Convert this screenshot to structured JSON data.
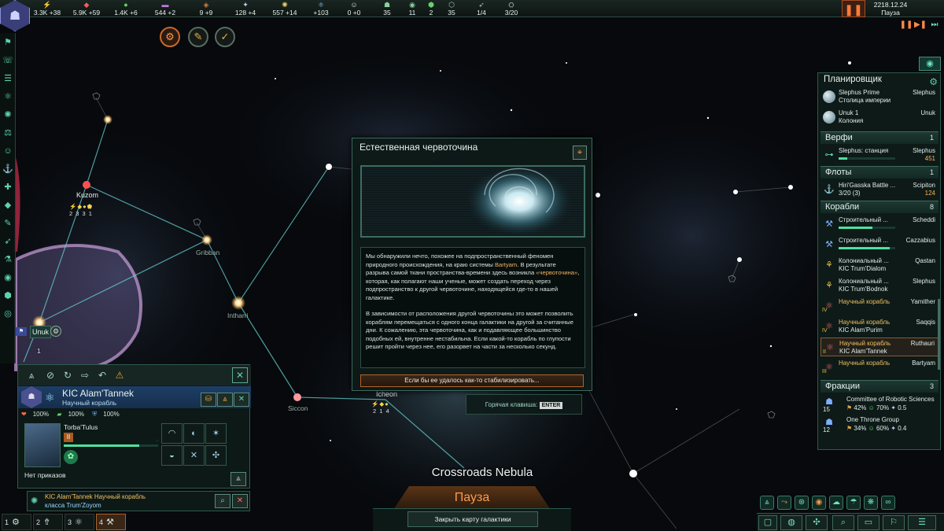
{
  "topbar": {
    "resources": [
      {
        "icon": "energy-icon",
        "glyph": "⚡",
        "value": "3.3K +38",
        "color": "#ffd24a"
      },
      {
        "icon": "minerals-icon",
        "glyph": "◆",
        "value": "5.9K +59",
        "color": "#ff5a5a"
      },
      {
        "icon": "food-icon",
        "glyph": "●",
        "value": "1.4K +6",
        "color": "#6ad06a"
      },
      {
        "icon": "alloys-icon",
        "glyph": "▬",
        "value": "544 +2",
        "color": "#c07ae0"
      },
      {
        "icon": "consumer-goods-icon",
        "glyph": "◈",
        "value": "9 +9",
        "color": "#e07a3a"
      },
      {
        "icon": "influence-icon",
        "glyph": "✦",
        "value": "128 +4",
        "color": "#b0d0f0"
      },
      {
        "icon": "unity-icon",
        "glyph": "✺",
        "value": "557 +14",
        "color": "#e0d070"
      },
      {
        "icon": "research-icon",
        "glyph": "⚛",
        "value": "+103",
        "color": "#7ac8f0"
      },
      {
        "icon": "amenities-icon",
        "glyph": "☺",
        "value": "0 +0",
        "color": "#e0e0e0"
      },
      {
        "icon": "pops-icon",
        "glyph": "☗",
        "value": "35",
        "color": "#8ad0a0"
      },
      {
        "icon": "planets-icon",
        "glyph": "◉",
        "value": "11",
        "color": "#8ad0a0"
      },
      {
        "icon": "stability-icon",
        "glyph": "⬢",
        "value": "2",
        "color": "#6ad06a"
      },
      {
        "icon": "sprawl-icon",
        "glyph": "⬡",
        "value": "35",
        "color": "#a0c0b0"
      },
      {
        "icon": "ships-icon",
        "glyph": "➶",
        "value": "1/4",
        "color": "#a0c0b0"
      },
      {
        "icon": "fleet-icon",
        "glyph": "⛭",
        "value": "3/20",
        "color": "#a0c0b0"
      }
    ],
    "date": "2218.12.24",
    "status": "Пауза"
  },
  "map": {
    "systems": [
      {
        "name": "Kuzom"
      },
      {
        "name": "Gribban"
      },
      {
        "name": "Intharri"
      },
      {
        "name": "Siccon"
      },
      {
        "name": "Icheon"
      },
      {
        "name": "Unuk"
      }
    ],
    "kuzom_res": "2 3 3 1",
    "icheon_res": "2 1 4",
    "unuk_count": "1",
    "nebula": "Crossroads Nebula"
  },
  "dialog": {
    "title": "Естественная червоточина",
    "p1_a": "Мы обнаружили нечто, похожее на подпространственный феномен природного происхождения, на краю системы ",
    "p1_sys": "Bartyam",
    "p1_b": ". В результате разрыва самой ткани пространства-времени здесь возникла ",
    "p1_hl": "«червоточина»",
    "p1_c": ", которая, как полагают наши ученые, может создать переход через подпространство к другой червоточине, находящейся где-то в нашей галактике.",
    "p2": "В зависимости от расположения другой червоточины это может позволить кораблям перемещаться с одного конца галактики на другой за считанные дни. К сожалению, эта червоточина, как и подавляющее большинство подобных ей, внутренне нестабильна. Если какой-то корабль по глупости решит пройти через нее, его разорвет на части за несколько секунд.",
    "option": "Если бы ее удалось как-то стабилизировать...",
    "hotkey_label": "Горячая клавиша:",
    "hotkey": "ENTER"
  },
  "planner": {
    "title": "Планировщик",
    "planets": [
      {
        "name": "Slephus Prime",
        "sub": "Столица империи",
        "right": "Slephus"
      },
      {
        "name": "Unuk 1",
        "sub": "Колония",
        "right": "Unuk"
      }
    ],
    "shipyards": {
      "label": "Верфи",
      "count": "1"
    },
    "shipyard_rows": [
      {
        "name": "Slephus: станция",
        "right": "Slephus",
        "value": "451"
      }
    ],
    "fleets": {
      "label": "Флоты",
      "count": "1"
    },
    "fleet_rows": [
      {
        "name": "Hiri'Gasska Battle ...",
        "sub": "3/20 (3)",
        "right": "Scipiton",
        "value": "124"
      }
    ],
    "ships": {
      "label": "Корабли",
      "count": "8"
    },
    "ship_rows": [
      {
        "name": "Строительный ...",
        "sub": "",
        "right": "Scheddi",
        "level": "",
        "progress": 0.6
      },
      {
        "name": "Строительный ...",
        "sub": "",
        "right": "Cazzabius",
        "level": "",
        "progress": 0.9
      },
      {
        "name": "Колониальный ...",
        "sub": "KIC Trum'Dialom",
        "right": "Qastan",
        "level": "",
        "progress": 0
      },
      {
        "name": "Колониальный ...",
        "sub": "KIC Trum'Bodnok",
        "right": "Slephus",
        "level": "",
        "progress": 0
      },
      {
        "name": "Научный корабль",
        "sub": "",
        "right": "Yamither",
        "level": "IV",
        "progress": 0
      },
      {
        "name": "Научный корабль",
        "sub": "KIC Alam'Purim",
        "right": "Saqqis",
        "level": "IV",
        "progress": 0
      },
      {
        "name": "Научный корабль",
        "sub": "KIC Alam'Tannek",
        "right": "Ruthauri",
        "level": "II",
        "progress": 0
      },
      {
        "name": "Научный корабль",
        "sub": "",
        "right": "Bartyam",
        "level": "III",
        "progress": 0
      }
    ],
    "factions": {
      "label": "Фракции",
      "count": "3"
    },
    "faction_rows": [
      {
        "name": "Committee of Robotic Sciences",
        "count": "15",
        "support": "42%",
        "happy": "70%",
        "influence": "0.5"
      },
      {
        "name": "One Throne Group",
        "count": "12",
        "support": "34%",
        "happy": "60%",
        "influence": "0.4"
      }
    ]
  },
  "ship": {
    "name": "KIC Alam'Tannek",
    "class": "Научный корабль",
    "hull": "100%",
    "armor": "100%",
    "shield": "100%",
    "leader": "Torba'Tulus",
    "leader_level": "II",
    "orders": "Нет приказов",
    "outliner_a": "KIC Alam'Tannek Научный корабль",
    "outliner_b": "класса Trum'Zoyom"
  },
  "groups": [
    {
      "num": "1",
      "glyph": "⚙"
    },
    {
      "num": "2",
      "glyph": "⇮"
    },
    {
      "num": "3",
      "glyph": "⚛"
    },
    {
      "num": "4",
      "glyph": "⚒"
    }
  ],
  "bottom": {
    "pause": "Пауза",
    "close_map": "Закрыть карту галактики"
  }
}
